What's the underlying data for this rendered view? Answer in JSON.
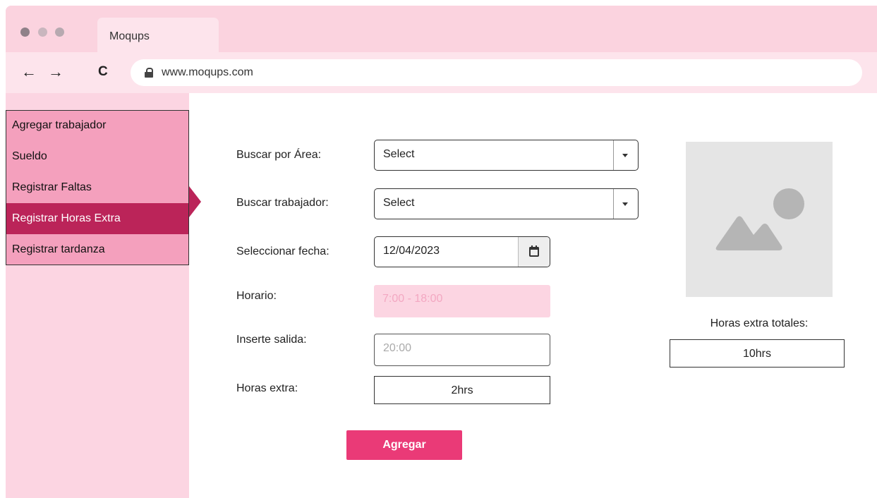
{
  "browser": {
    "tab_title": "Moqups",
    "url": "www.moqups.com",
    "nav": {
      "back": "←",
      "forward": "→",
      "reload": "C"
    },
    "window_dots_colors": [
      "#8f8189",
      "#c9b6be",
      "#b7a9b0"
    ]
  },
  "sidebar": {
    "items": [
      {
        "label": "Agregar trabajador",
        "selected": false
      },
      {
        "label": "Sueldo",
        "selected": false
      },
      {
        "label": "Registrar Faltas",
        "selected": false
      },
      {
        "label": "Registrar Horas Extra",
        "selected": true
      },
      {
        "label": "Registrar tardanza",
        "selected": false
      }
    ]
  },
  "form": {
    "area_label": "Buscar por Área:",
    "area_value": "Select",
    "worker_label": "Buscar trabajador:",
    "worker_value": "Select",
    "date_label": "Seleccionar fecha:",
    "date_value": "12/04/2023",
    "schedule_label": "Horario:",
    "schedule_value": "7:00 - 18:00",
    "exit_label": "Inserte salida:",
    "exit_placeholder": "20:00",
    "overtime_label": "Horas extra:",
    "overtime_value": "2hrs",
    "submit_label": "Agregar"
  },
  "summary": {
    "total_label": "Horas extra totales:",
    "total_value": "10hrs"
  },
  "colors": {
    "accent": "#ea3a77",
    "sidebar_item": "#f4a0bd",
    "sidebar_selected": "#bb2459",
    "chrome": "#fbd3df"
  }
}
